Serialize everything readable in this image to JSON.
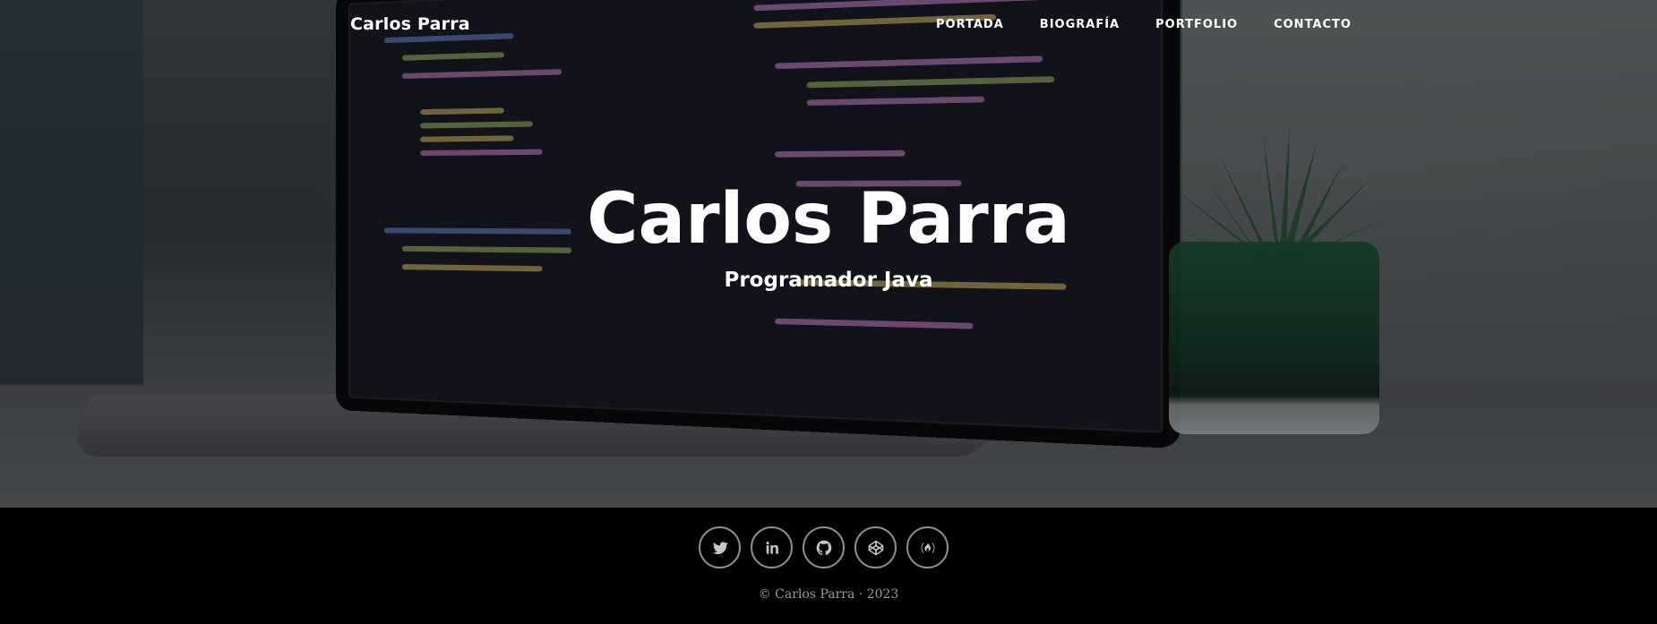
{
  "nav": {
    "brand": "Carlos Parra",
    "links": [
      {
        "label": "PORTADA"
      },
      {
        "label": "BIOGRAFÍA"
      },
      {
        "label": "PORTFOLIO"
      },
      {
        "label": "CONTACTO"
      }
    ]
  },
  "hero": {
    "title": "Carlos Parra",
    "subtitle": "Programador Java"
  },
  "footer": {
    "social": [
      {
        "icon": "twitter-icon"
      },
      {
        "icon": "linkedin-icon"
      },
      {
        "icon": "github-icon"
      },
      {
        "icon": "codepen-icon"
      },
      {
        "icon": "freecodecamp-icon"
      }
    ],
    "copyright": "© Carlos Parra · 2023"
  }
}
